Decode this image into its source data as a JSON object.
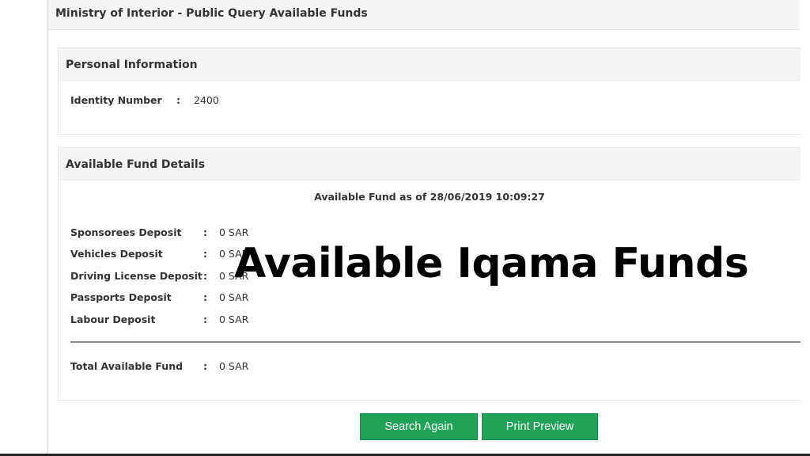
{
  "page": {
    "title": "Ministry of Interior - Public Query Available Funds"
  },
  "personal_info": {
    "heading": "Personal Information",
    "identity_label": "Identity Number",
    "colon": ":",
    "identity_value": "2400"
  },
  "fund_details": {
    "heading": "Available Fund Details",
    "as_of": "Available Fund as of 28/06/2019 10:09:27",
    "colon": ":",
    "items": [
      {
        "label": "Sponsorees Deposit",
        "value": "0 SAR"
      },
      {
        "label": "Vehicles Deposit",
        "value": "0 SAR"
      },
      {
        "label": "Driving License Deposit",
        "value": "0 SAR"
      },
      {
        "label": "Passports Deposit",
        "value": "0 SAR"
      },
      {
        "label": "Labour Deposit",
        "value": "0 SAR"
      }
    ],
    "total": {
      "label": "Total Available Fund",
      "value": "0 SAR"
    }
  },
  "overlay_text": "Available Iqama Funds",
  "buttons": {
    "search_again": "Search Again",
    "print_preview": "Print Preview"
  },
  "colors": {
    "button_green": "#1fa357",
    "panel_header": "#f5f5f5"
  }
}
